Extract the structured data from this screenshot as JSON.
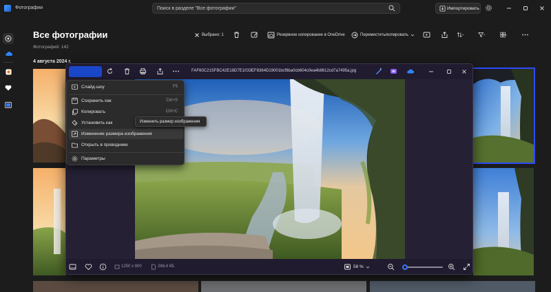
{
  "app": {
    "title": "Фотографии",
    "search_placeholder": "Поиск в разделе \"Все фотографии\"",
    "import_label": "Импортировать",
    "icons": [
      "photos-app-icon",
      "search-icon",
      "import-icon",
      "gear-icon",
      "minimize-icon",
      "maximize-icon",
      "close-icon"
    ]
  },
  "nav": {
    "items": [
      "home-icon",
      "onedrive-icon",
      "iphone-photos-icon",
      "favorites-icon",
      "folders-icon"
    ]
  },
  "page": {
    "title": "Все фотографии",
    "count": "Фотографий: 142",
    "date_header": "4 августа 2024 г."
  },
  "toolbar": {
    "selected_label": "Выбрано: 1",
    "backup_label": "Резервное копирование в OneDrive",
    "move_copy_label": "Переместить/копировать",
    "icons": [
      "close-selection-icon",
      "delete-icon",
      "edit-icon",
      "onedrive-backup-icon",
      "move-icon",
      "slideshow-icon",
      "share-icon",
      "sort-icon",
      "filter-icon",
      "view-icon",
      "more-icon"
    ]
  },
  "viewer": {
    "filename": "FAF60C21SFBC42E18D7E1033EF8364D19001bcf8ba0cb604c0ea4b8612cd7a7495a.jpg",
    "dimensions": "1250 x 900",
    "filesize": "268,4 КБ",
    "zoom": "58 %",
    "zoom_level": 0.05,
    "toolbar_icons": [
      "edit-image-button",
      "rotate-icon",
      "delete-icon",
      "print-icon",
      "share-icon",
      "more-icon"
    ],
    "topright_icons": [
      "designer-icon",
      "clipchamp-icon",
      "onedrive-icon",
      "minimize-icon",
      "maximize-icon",
      "close-icon"
    ]
  },
  "menu": {
    "items": [
      {
        "label": "Слайд-шоу",
        "shortcut": "F5",
        "icon": "slideshow-icon"
      },
      {
        "label": "Сохранить как",
        "shortcut": "Ctrl+S",
        "icon": "save-as-icon"
      },
      {
        "label": "Копировать",
        "shortcut": "Ctrl+C",
        "icon": "copy-icon"
      },
      {
        "label": "Установить как",
        "shortcut": "",
        "icon": "set-as-icon"
      },
      {
        "label": "Изменение размера изображения",
        "shortcut": "",
        "icon": "resize-icon"
      },
      {
        "label": "Открыть в проводнике",
        "shortcut": "",
        "icon": "folder-icon"
      },
      {
        "label": "Параметры",
        "shortcut": "",
        "icon": "gear-icon"
      }
    ]
  },
  "tooltip": {
    "text": "Изменить размер изображения"
  }
}
